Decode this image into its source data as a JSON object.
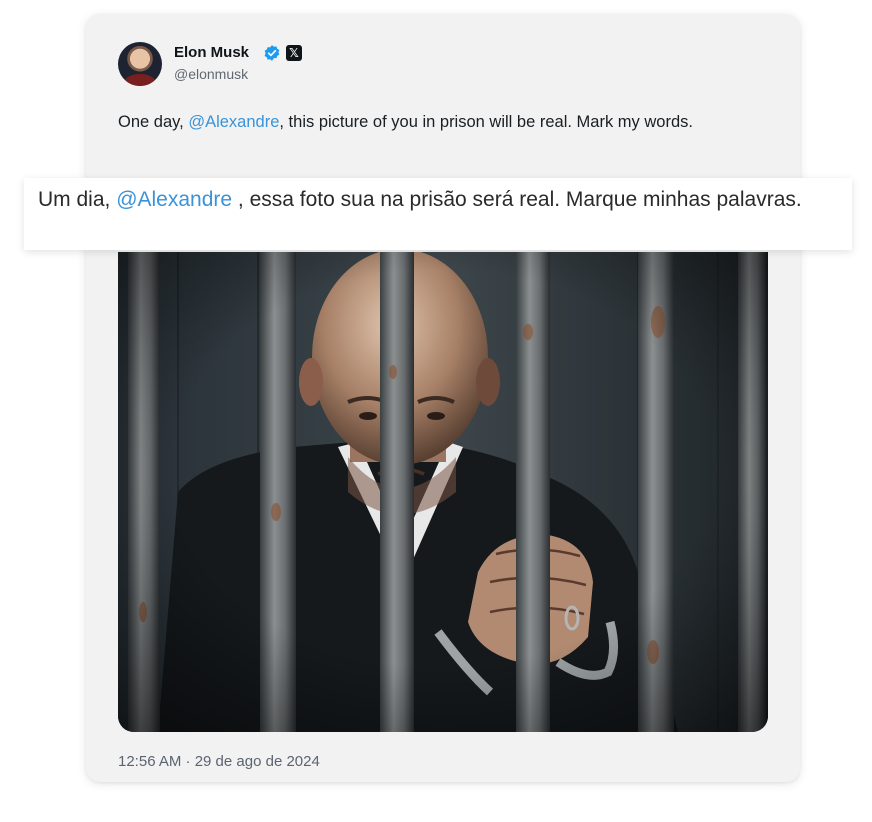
{
  "tweet": {
    "author_name": "Elon Musk",
    "handle": "@elonmusk",
    "text_before": "One day, ",
    "mention": "@Alexandre",
    "text_after": ", this picture of you in prison will be real. Mark my words.",
    "timestamp": "12:56 AM · 29 de ago de 2024",
    "image_alt": "bald man in black robe holding prison bars"
  },
  "translation": {
    "text_before": "Um dia, ",
    "mention": "@Alexandre",
    "text_after": " , essa foto sua na prisão será real. Marque minhas palavras."
  },
  "icons": {
    "verified": "verified-badge-icon",
    "x_logo": "x-logo-icon"
  },
  "colors": {
    "mention": "#3a93d9",
    "verified": "#1d9bf0"
  }
}
